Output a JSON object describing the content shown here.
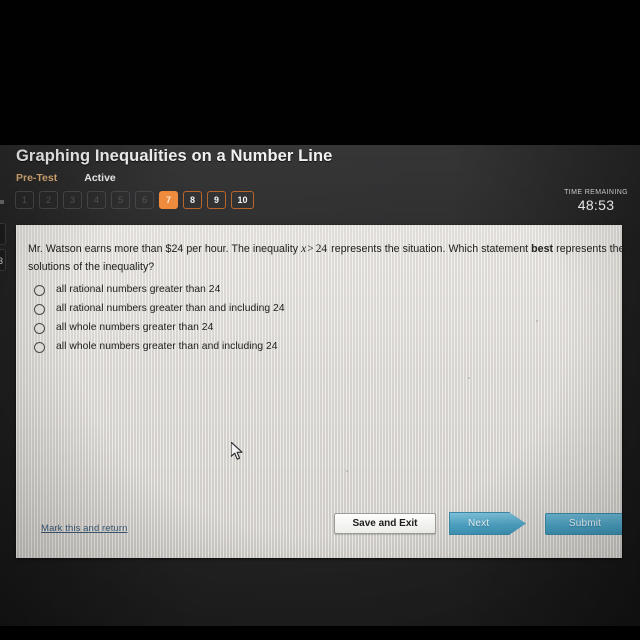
{
  "header": {
    "title": "Graphing Inequalities on a Number Line",
    "breadcrumb_pretest": "Pre-Test",
    "breadcrumb_active": "Active",
    "timer_label": "TIME REMAINING",
    "timer_value": "48:53",
    "edge_fragment_top": "",
    "edge_fragment_bottom": "3"
  },
  "question_nav": {
    "items": [
      {
        "label": "1",
        "state": "done"
      },
      {
        "label": "2",
        "state": "done"
      },
      {
        "label": "3",
        "state": "done"
      },
      {
        "label": "4",
        "state": "done"
      },
      {
        "label": "5",
        "state": "done"
      },
      {
        "label": "6",
        "state": "done"
      },
      {
        "label": "7",
        "state": "current"
      },
      {
        "label": "8",
        "state": "todo"
      },
      {
        "label": "9",
        "state": "todo"
      },
      {
        "label": "10",
        "state": "todo"
      }
    ]
  },
  "question": {
    "part1": "Mr. Watson earns more than $24 per hour. The inequality ",
    "variable": "x",
    "operator": ">",
    "number": "24",
    "part2": " represents the situation. Which statement ",
    "emphasis": "best",
    "part3": " represents the solutions of the inequality?",
    "full_text": "Mr. Watson earns more than $24 per hour. The inequality x > 24 represents the situation. Which statement best represents the solutions of the inequality?"
  },
  "options": [
    {
      "label": "all rational numbers greater than 24",
      "selected": false
    },
    {
      "label": "all rational numbers greater than and including 24",
      "selected": false
    },
    {
      "label": "all whole numbers greater than 24",
      "selected": false
    },
    {
      "label": "all whole numbers greater than and including 24",
      "selected": false
    }
  ],
  "footer": {
    "mark_link": "Mark this and return",
    "save_exit_label": "Save and Exit",
    "next_label": "Next",
    "submit_label": "Submit"
  },
  "colors": {
    "accent_orange": "#ef8b3c",
    "accent_orange_border": "#b9642b",
    "header_bg": "#2b2b2c",
    "card_bg": "#dedbd6",
    "button_blue": "#4ba2c3",
    "link_blue": "#3c5c78",
    "breadcrumb_tan": "#d9ab74"
  }
}
